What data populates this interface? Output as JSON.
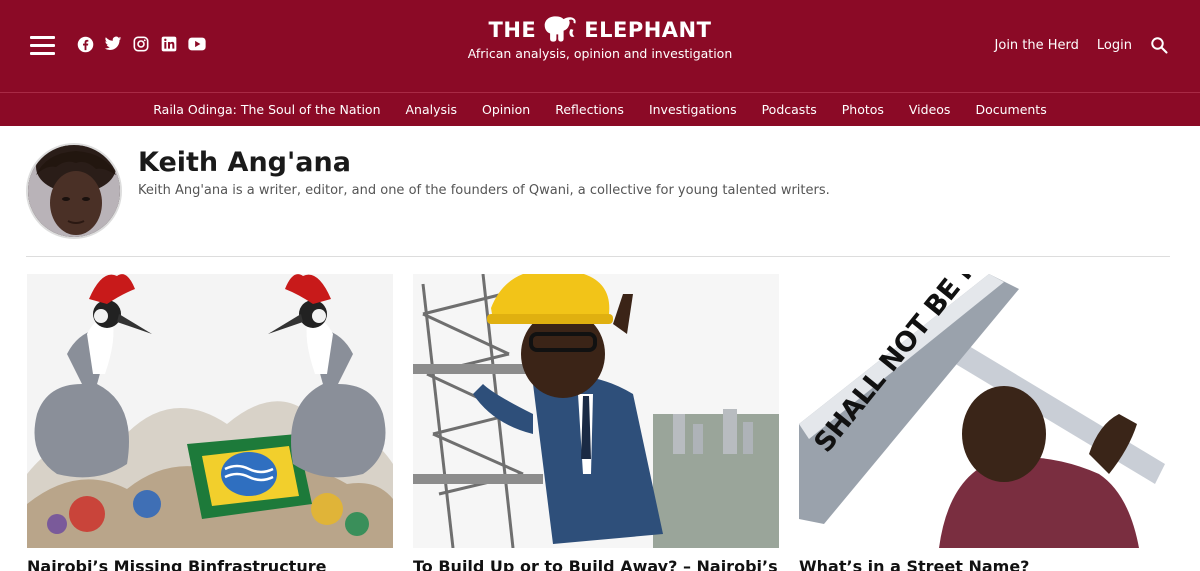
{
  "header": {
    "logo_left": "THE",
    "logo_right": "ELEPHANT",
    "tagline": "African analysis, opinion and investigation",
    "social_icons": [
      "facebook-icon",
      "twitter-icon",
      "instagram-icon",
      "linkedin-icon",
      "youtube-icon"
    ],
    "join_label": "Join the Herd",
    "login_label": "Login",
    "brand_color": "#8b0a26"
  },
  "nav": {
    "items": [
      "Raila Odinga: The Soul of the Nation",
      "Analysis",
      "Opinion",
      "Reflections",
      "Investigations",
      "Podcasts",
      "Photos",
      "Videos",
      "Documents"
    ]
  },
  "author": {
    "name": "Keith Ang'ana",
    "bio": "Keith Ang'ana is a writer, editor, and one of the founders of Qwani, a collective for young talented writers."
  },
  "articles": [
    {
      "title": "Nairobi’s Missing Binfrastructure",
      "image": "illustration of two crested cranes over a heap of trash and a Kenya flag"
    },
    {
      "title": "To Build Up or to Build Away? – Nairobi’s",
      "image": "caricature of a man in hard hat climbing scaffolding above city"
    },
    {
      "title": "What’s in a Street Name?",
      "image": "man lifting a street sign that reads SHALL NOT BE NAMED",
      "sign_text": "SHALL NOT BE NAMED"
    }
  ]
}
